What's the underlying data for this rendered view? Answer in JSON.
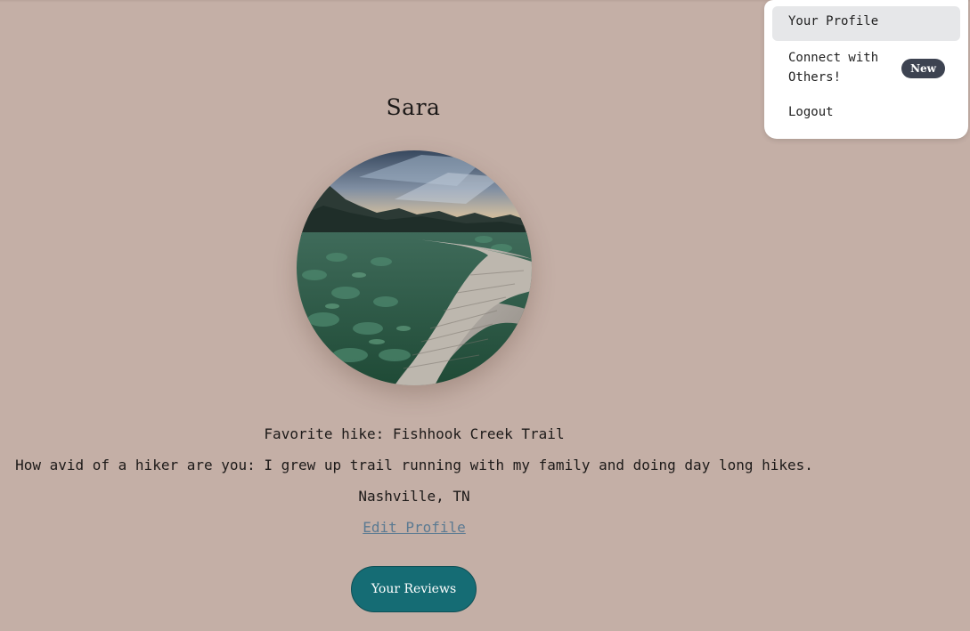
{
  "profile": {
    "name": "Sara",
    "favorite_hike": "Favorite hike: Fishhook Creek Trail",
    "avid_hiker": "How avid of a hiker are you: I grew up trail running with my family and doing day long hikes.",
    "location": "Nashville, TN",
    "edit_label": "Edit Profile",
    "reviews_label": "Your Reviews"
  },
  "menu": {
    "items": [
      {
        "label": "Your Profile"
      },
      {
        "label": "Connect with Others!",
        "badge": "New"
      },
      {
        "label": "Logout"
      }
    ]
  },
  "colors": {
    "background": "#c4afa6",
    "reviews_button": "#156c74",
    "badge": "#3d4351",
    "link": "#5b7a92"
  }
}
